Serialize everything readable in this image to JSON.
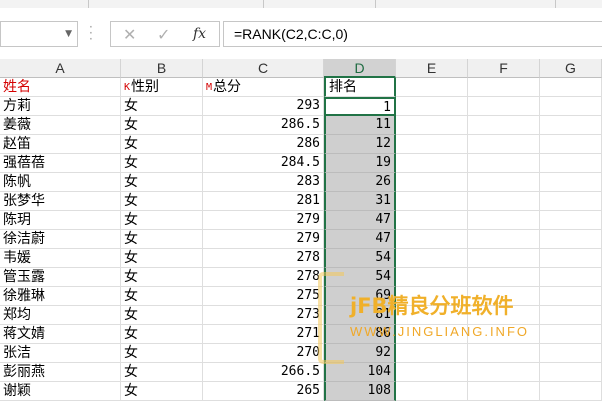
{
  "formula_bar": {
    "name_box_value": "",
    "cancel_icon": "cancel-x-icon",
    "enter_icon": "checkmark-icon",
    "fx_label": "fx",
    "formula": "=RANK(C2,C:C,0)"
  },
  "columns": [
    "A",
    "B",
    "C",
    "D",
    "E",
    "F",
    "G"
  ],
  "active_column": "D",
  "header_row": {
    "name": "姓名",
    "gender": "性别",
    "total": "总分",
    "rank": "排名",
    "gender_marker": "K",
    "total_marker": "M"
  },
  "rows": [
    {
      "name": "方莉",
      "gender": "女",
      "total": "293",
      "rank": "1"
    },
    {
      "name": "姜薇",
      "gender": "女",
      "total": "286.5",
      "rank": "11"
    },
    {
      "name": "赵笛",
      "gender": "女",
      "total": "286",
      "rank": "12"
    },
    {
      "name": "强蓓蓓",
      "gender": "女",
      "total": "284.5",
      "rank": "19"
    },
    {
      "name": "陈帆",
      "gender": "女",
      "total": "283",
      "rank": "26"
    },
    {
      "name": "张梦华",
      "gender": "女",
      "total": "281",
      "rank": "31"
    },
    {
      "name": "陈玥",
      "gender": "女",
      "total": "279",
      "rank": "47"
    },
    {
      "name": "徐洁蔚",
      "gender": "女",
      "total": "279",
      "rank": "47"
    },
    {
      "name": "韦媛",
      "gender": "女",
      "total": "278",
      "rank": "54"
    },
    {
      "name": "管玉露",
      "gender": "女",
      "total": "278",
      "rank": "54"
    },
    {
      "name": "徐雅琳",
      "gender": "女",
      "total": "275",
      "rank": "69"
    },
    {
      "name": "郑均",
      "gender": "女",
      "total": "273",
      "rank": "81"
    },
    {
      "name": "蒋文婧",
      "gender": "女",
      "total": "271",
      "rank": "86"
    },
    {
      "name": "张洁",
      "gender": "女",
      "total": "270",
      "rank": "92"
    },
    {
      "name": "彭丽燕",
      "gender": "女",
      "total": "266.5",
      "rank": "104"
    },
    {
      "name": "谢颖",
      "gender": "女",
      "total": "265",
      "rank": "108"
    }
  ],
  "watermark": {
    "title": "jFB精良分班软件",
    "url": "WWW.JINGLIANG.INFO"
  },
  "colors": {
    "accent_green": "#217346",
    "header_red": "#d40000",
    "selection_gray": "#cfcfcf",
    "watermark_orange": "#f0b02a"
  }
}
